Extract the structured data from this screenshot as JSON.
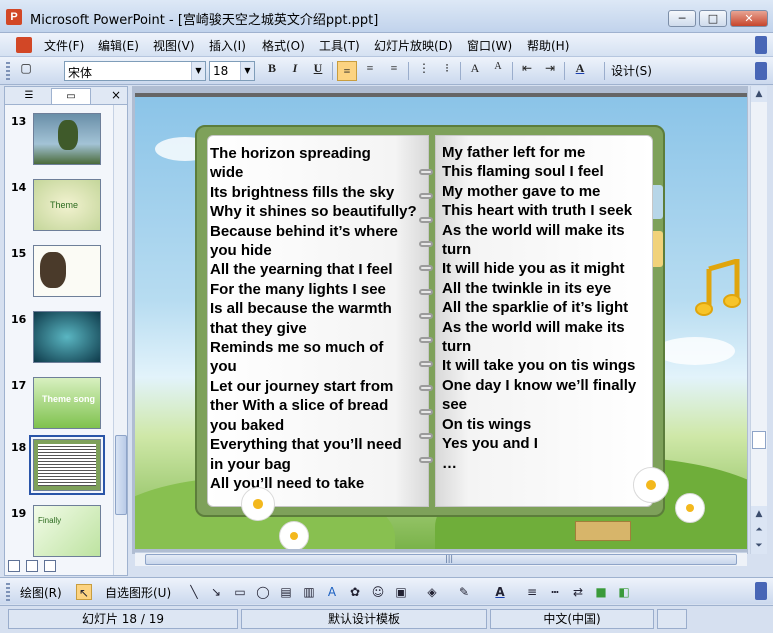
{
  "window": {
    "title": "Microsoft PowerPoint - [宫崎骏天空之城英文介绍ppt.ppt]",
    "app_icon": "P",
    "minimize_glyph": "─",
    "maximize_glyph": "□",
    "close_glyph": "✕"
  },
  "menu": {
    "items": [
      "文件(F)",
      "编辑(E)",
      "视图(V)",
      "插入(I)",
      "格式(O)",
      "工具(T)",
      "幻灯片放映(D)",
      "窗口(W)",
      "帮助(H)"
    ]
  },
  "format_toolbar": {
    "font_name": "宋体",
    "font_size": "18",
    "bold": "B",
    "italic": "I",
    "underline": "U",
    "design_label": "设计(S)"
  },
  "slide_panel": {
    "tabs": {
      "outline_icon": "outline-icon",
      "slides_icon": "slides-icon",
      "close": "×"
    },
    "thumbnails": [
      {
        "number": "13",
        "label": ""
      },
      {
        "number": "14",
        "label": "Theme"
      },
      {
        "number": "15",
        "label": ""
      },
      {
        "number": "16",
        "label": ""
      },
      {
        "number": "17",
        "label": "Theme song"
      },
      {
        "number": "18",
        "label": ""
      },
      {
        "number": "19",
        "label": "Finally"
      }
    ],
    "selected": "18"
  },
  "slide": {
    "left_page": [
      "The horizon spreading",
      "wide",
      "Its brightness fills the sky",
      "Why it shines so beautifully?",
      "Because behind it’s where",
      "you hide",
      "All the yearning that I feel",
      "For the many lights I see",
      "Is all because the warmth",
      "that they give",
      "Reminds me so much of",
      "you",
      "Let our journey start from",
      "ther With a slice of bread",
      "you baked",
      "Everything that you’ll need",
      "in your bag",
      "All you’ll need to take"
    ],
    "right_page": [
      "My father left for me",
      "This flaming soul I feel",
      "My mother gave to me",
      "This heart with truth I seek",
      "As the world will make its",
      "turn",
      "It will hide you as it might",
      "All the twinkle in its eye",
      "All the sparklie of it’s light",
      "As the world will make its",
      "turn",
      "It will take you on tis wings",
      "One day I know we’ll finally",
      "see",
      "On tis wings",
      "Yes you and I",
      "…"
    ],
    "decoration_icon": "music-note-icon"
  },
  "draw_toolbar": {
    "draw_label": "绘图(R)",
    "autoshapes_label": "自选图形(U)"
  },
  "status": {
    "slide_info": "幻灯片 18 / 19",
    "template": "默认设计模板",
    "language": "中文(中国)"
  },
  "colors": {
    "accent": "#4866b6",
    "book_cover": "#7ea15a",
    "active_button": "#fcd381"
  }
}
